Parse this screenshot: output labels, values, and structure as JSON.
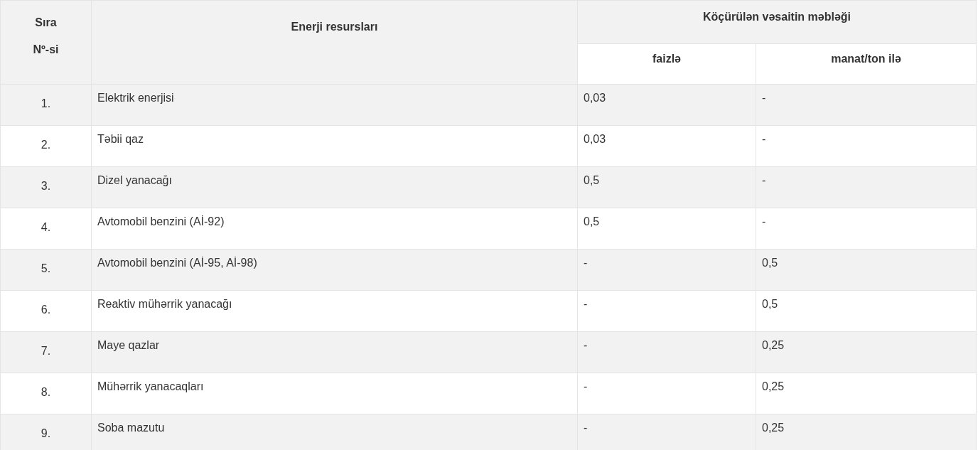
{
  "table": {
    "columns": [
      {
        "label": "Sıra\nNº-si"
      },
      {
        "label": "Enerji resursları"
      },
      {
        "label": "Köçürülən vəsaitin məbləği",
        "children": [
          {
            "label": "faizlə"
          },
          {
            "label": "manat/ton ilə"
          }
        ]
      }
    ],
    "rows": [
      {
        "number": "1.",
        "resource": "Elektrik enerjisi",
        "percent": "0,03",
        "per_ton": "-"
      },
      {
        "number": "2.",
        "resource": "Təbii qaz",
        "percent": "0,03",
        "per_ton": "-"
      },
      {
        "number": "3.",
        "resource": "Dizel yanacağı",
        "percent": "0,5",
        "per_ton": "-"
      },
      {
        "number": "4.",
        "resource": "Avtomobil benzini (Aİ-92)",
        "percent": "0,5",
        "per_ton": "-"
      },
      {
        "number": "5.",
        "resource": "Avtomobil benzini (Aİ-95, Aİ-98)",
        "percent": "-",
        "per_ton": "0,5"
      },
      {
        "number": "6.",
        "resource": "Reaktiv mühərrik yanacağı",
        "percent": "-",
        "per_ton": "0,5"
      },
      {
        "number": "7.",
        "resource": "Maye qazlar",
        "percent": "-",
        "per_ton": "0,25"
      },
      {
        "number": "8.",
        "resource": "Mühərrik yanacaqları",
        "percent": "-",
        "per_ton": "0,25"
      },
      {
        "number": "9.",
        "resource": "Soba mazutu",
        "percent": "-",
        "per_ton": "0,25"
      }
    ]
  }
}
